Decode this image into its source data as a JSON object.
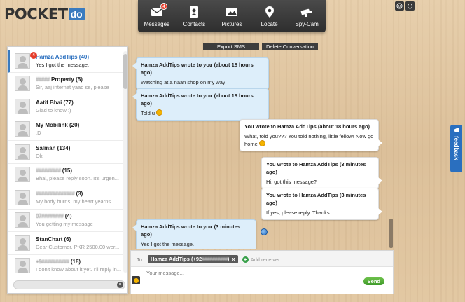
{
  "logo": {
    "text": "POCKET",
    "suffix": "do"
  },
  "nav": {
    "messages": {
      "label": "Messages",
      "badge": "4"
    },
    "contacts": {
      "label": "Contacts"
    },
    "pictures": {
      "label": "Pictures"
    },
    "locate": {
      "label": "Locate"
    },
    "spycam": {
      "label": "Spy-Cam"
    }
  },
  "toolbar": {
    "export": "Export SMS",
    "delete": "Delete Conversation"
  },
  "contacts": [
    {
      "name": "Hamza AddTips (40)",
      "preview": "Yes I got the message.",
      "badge": "4",
      "active": true
    },
    {
      "name_hidden": "#####",
      "name": "Property (5)",
      "preview": "Sir, aaj internet yaad se, please"
    },
    {
      "name": "Aatif Bhai (77)",
      "preview": "Glad to know :)"
    },
    {
      "name": "My Mobilink (20)",
      "preview": ":D"
    },
    {
      "name": "Salman (134)",
      "preview": "Ok"
    },
    {
      "name_hidden": "#########",
      "name": "(15)",
      "preview": "Bhai, please reply soon. It's urgen..."
    },
    {
      "name_hidden": "##############",
      "name": "(3)",
      "preview": "My body burns, my heart yearns."
    },
    {
      "name_hidden": "07########",
      "name": "(4)",
      "preview": "You getting my message"
    },
    {
      "name": "StanChart (6)",
      "preview": "Dear Customer, PKR 2500.00 wer..."
    },
    {
      "name_hidden": "+9##########",
      "name": "(18)",
      "preview": "I don't know about it yet. I'll reply in..."
    }
  ],
  "search": {
    "value": "",
    "clear_icon": "×"
  },
  "messages": [
    {
      "direction": "in",
      "header": "Hamza AddTips wrote to you (about 18 hours ago)",
      "body": "Watching at a naan shop on my way"
    },
    {
      "direction": "in",
      "header": "Hamza AddTips wrote to you (about 18 hours ago)",
      "body": "Told u"
    },
    {
      "direction": "out",
      "header": "You wrote to Hamza AddTips (about 18 hours ago)",
      "body": "What, told you??? You told nothing, little fellow! Now go home"
    },
    {
      "direction": "out",
      "header": "You wrote to Hamza AddTips (3 minutes ago)",
      "body": "Hi, got this message?"
    },
    {
      "direction": "out",
      "header": "You wrote to Hamza AddTips (3 minutes ago)",
      "body": "If yes, please reply. Thanks"
    },
    {
      "direction": "in",
      "header": "Hamza AddTips wrote to you (3 minutes ago)",
      "body": "Yes I got the message."
    }
  ],
  "compose": {
    "to_label": "To:",
    "recipient": "Hamza AddTips (+92",
    "recipient_hidden": "##########",
    "recipient_tail": ")",
    "remove": "x",
    "add_receiver": "Add receiver...",
    "placeholder": "Your message...",
    "send": "Send"
  },
  "feedback": {
    "label": "feedback"
  },
  "colors": {
    "accent": "#2a6fbf",
    "badge": "#e53c2a",
    "send": "#3f9a2a",
    "bubble_in": "#ddeefa"
  }
}
